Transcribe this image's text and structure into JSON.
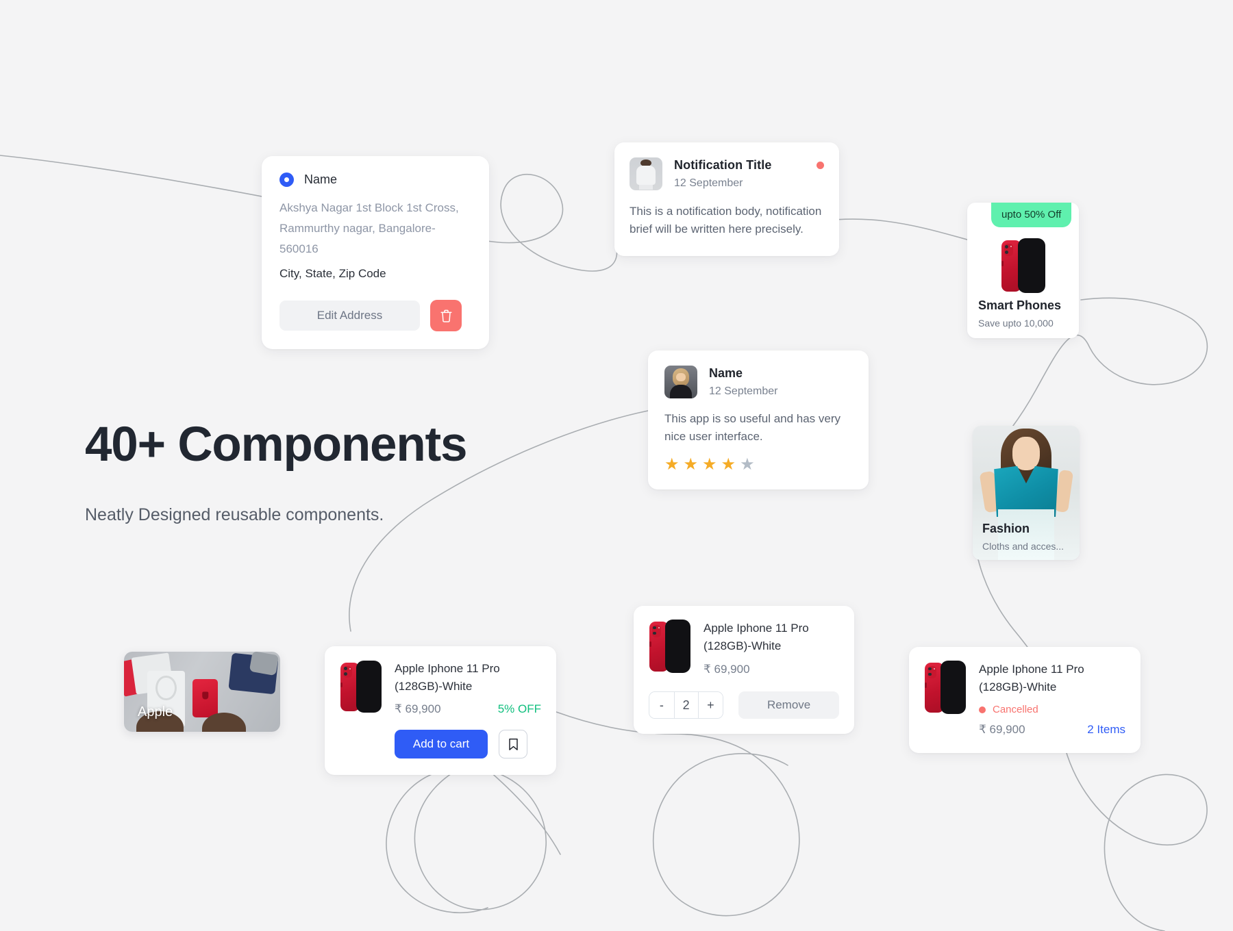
{
  "page": {
    "background_color": "#f4f4f5",
    "accent_blue": "#2f5cf6",
    "accent_red": "#f8736f",
    "accent_green": "#0fbf7e",
    "badge_green": "#5ff0ae"
  },
  "hero": {
    "title": "40+ Components",
    "subtitle": "Neatly Designed reusable components."
  },
  "address_card": {
    "name": "Name",
    "address_lines": "Akshya Nagar 1st Block 1st Cross, Rammurthy nagar, Bangalore-560016",
    "city_state_zip": "City, State, Zip Code",
    "edit_label": "Edit Address",
    "delete_icon": "trash-icon",
    "radio_icon": "radio-selected-icon"
  },
  "notification_card": {
    "avatar_icon": "avatar-man",
    "title": "Notification Title",
    "date": "12 September",
    "body": "This is a notification body, notification brief will be written here precisely.",
    "unread_dot": "unread-dot"
  },
  "review_card": {
    "avatar_icon": "avatar-woman",
    "name": "Name",
    "date": "12 September",
    "body": "This app is so useful and has very nice user interface.",
    "rating": 4,
    "rating_max": 5,
    "star_filled_color": "#f5ab26",
    "star_empty_color": "#b3bcc6"
  },
  "category_smartphones": {
    "badge": "upto 50% Off",
    "title": "Smart Phones",
    "subtitle": "Save upto 10,000",
    "image_icon": "iphone-red-product"
  },
  "category_fashion": {
    "title": "Fashion",
    "subtitle": "Cloths and acces...",
    "image_icon": "fashion-model-teal-dress"
  },
  "apple_banner": {
    "label": "Apple",
    "image_icon": "iphone-unboxing-photo"
  },
  "product_card": {
    "title": "Apple Iphone 11 Pro (128GB)-White",
    "price": "₹ 69,900",
    "discount": "5% OFF",
    "add_to_cart_label": "Add to cart",
    "bookmark_icon": "bookmark-icon",
    "image_icon": "iphone-red-product"
  },
  "cart_card": {
    "title": "Apple Iphone 11 Pro (128GB)-White",
    "price": "₹ 69,900",
    "decrement_label": "-",
    "quantity": "2",
    "increment_label": "+",
    "remove_label": "Remove",
    "image_icon": "iphone-red-product"
  },
  "order_card": {
    "title": "Apple Iphone 11 Pro (128GB)-White",
    "status": "Cancelled",
    "status_dot": "status-dot-cancelled",
    "price": "₹ 69,900",
    "items": "2 Items",
    "image_icon": "iphone-red-product"
  }
}
